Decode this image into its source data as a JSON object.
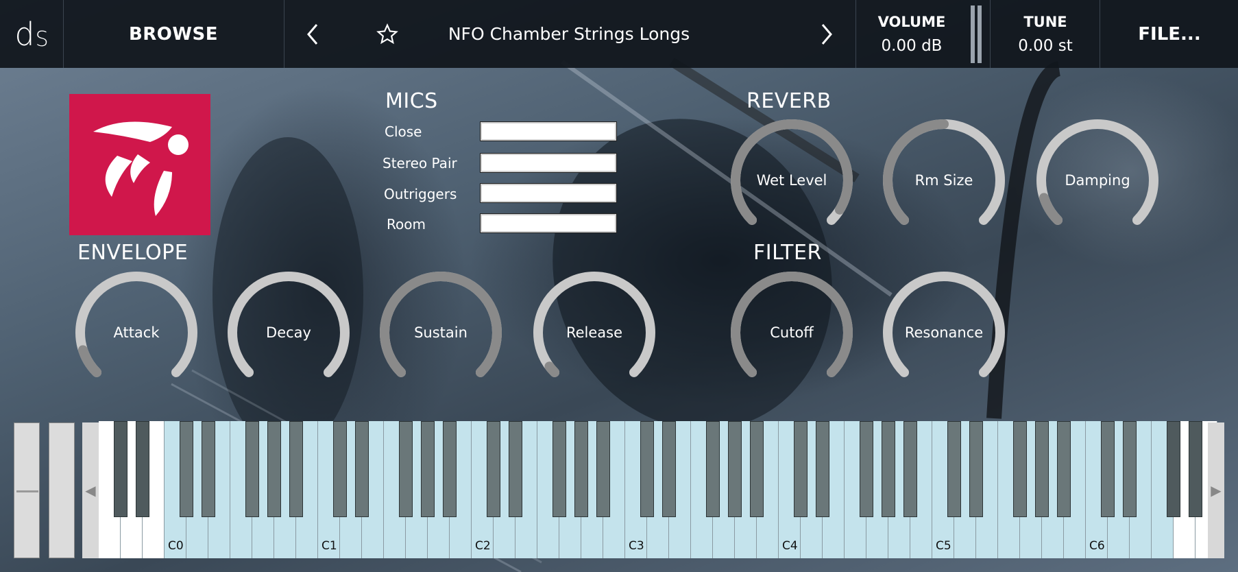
{
  "header": {
    "logo_main": "d",
    "logo_sub": "S",
    "browse_label": "BROWSE",
    "prev_icon": "chevron-left-icon",
    "favorite_icon": "star-icon",
    "preset_name": "NFO Chamber Strings Longs",
    "next_icon": "chevron-right-icon",
    "volume_label": "VOLUME",
    "volume_value": "0.00 dB",
    "tune_label": "TUNE",
    "tune_value": "0.00 st",
    "file_label": "FILE..."
  },
  "sections": {
    "mics": "MICS",
    "reverb": "REVERB",
    "envelope": "ENVELOPE",
    "filter": "FILTER"
  },
  "mics": [
    {
      "label": "Close",
      "value": ""
    },
    {
      "label": "Stereo Pair",
      "value": ""
    },
    {
      "label": "Outriggers",
      "value": ""
    },
    {
      "label": "Room",
      "value": ""
    }
  ],
  "knobs": {
    "wet_level": {
      "label": "Wet Level",
      "value": 0.95
    },
    "rm_size": {
      "label": "Rm Size",
      "value": 0.5
    },
    "damping": {
      "label": "Damping",
      "value": 0.1
    },
    "attack": {
      "label": "Attack",
      "value": 0.1
    },
    "decay": {
      "label": "Decay",
      "value": 0.0
    },
    "sustain": {
      "label": "Sustain",
      "value": 1.0
    },
    "release": {
      "label": "Release",
      "value": 0.03
    },
    "cutoff": {
      "label": "Cutoff",
      "value": 1.0
    },
    "resonance": {
      "label": "Resonance",
      "value": 0.0
    }
  },
  "keyboard": {
    "octave_labels": [
      "C0",
      "C1",
      "C2",
      "C3",
      "C4",
      "C5",
      "C6"
    ],
    "scroll_left_icon": "triangle-left-icon",
    "scroll_right_icon": "triangle-right-icon"
  },
  "colors": {
    "brand_red": "#d0174b",
    "key_in_range": "#c4e3ec",
    "knob_track": "#c9c9c9",
    "knob_value": "#8a8a8a"
  }
}
